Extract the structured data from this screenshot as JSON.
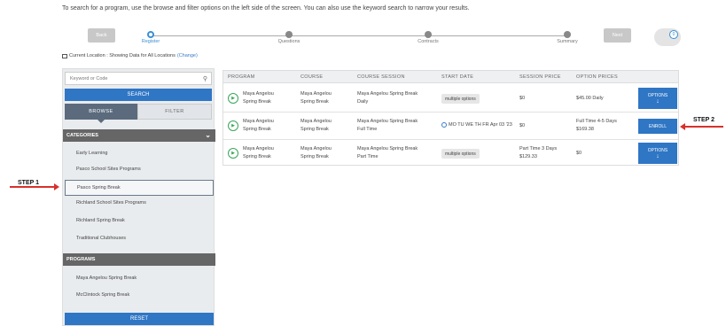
{
  "intro_text": "To search for a program, use the browse and filter options on the left side of the screen. You can also use the keyword search to narrow your results.",
  "wizard": {
    "back_label": "Back",
    "next_label": "Next",
    "steps": [
      {
        "label": "Register",
        "active": true
      },
      {
        "label": "Questions",
        "active": false
      },
      {
        "label": "Contracts",
        "active": false
      },
      {
        "label": "Summary",
        "active": false
      }
    ],
    "cart_count": "0"
  },
  "location": {
    "text": "Current Location : Showing Data for All Locations",
    "change_label": "(Change)"
  },
  "sidebar": {
    "keyword_placeholder": "Keyword or Code",
    "search_label": "SEARCH",
    "browse_label": "BROWSE",
    "filter_label": "FILTER",
    "categories_label": "CATEGORIES",
    "categories": [
      "Early Learning",
      "Pasco School Sites Programs",
      "Pasco Spring Break",
      "Richland School Sites Programs",
      "Richland Spring Break",
      "Traditional Clubhouses"
    ],
    "selected_category": "Pasco Spring Break",
    "programs_label": "PROGRAMS",
    "programs": [
      "Maya Angelou Spring Break",
      "McClintock Spring Break"
    ],
    "reset_label": "RESET"
  },
  "annotations": {
    "step1": "STEP 1",
    "step2": "STEP 2",
    "arrow_color": "#d9302c"
  },
  "table": {
    "headers": [
      "PROGRAM",
      "COURSE",
      "COURSE SESSION",
      "START DATE",
      "SESSION PRICE",
      "OPTION PRICES"
    ],
    "rows": [
      {
        "program": [
          "Maya Angelou",
          "Spring Break"
        ],
        "course": [
          "Maya Angelou",
          "Spring Break"
        ],
        "session": [
          "Maya Angelou Spring Break",
          "Daily"
        ],
        "start_date": "multiple options",
        "session_price": "$0",
        "option_prices": "$45.00 Daily",
        "action": "OPTIONS"
      },
      {
        "program": [
          "Maya Angelou",
          "Spring Break"
        ],
        "course": [
          "Maya Angelou",
          "Spring Break"
        ],
        "session": [
          "Maya Angelou Spring Break",
          "Full Time"
        ],
        "start_date": "MO TU WE TH FR Apr 03 '23",
        "session_price": "$0",
        "option_prices": [
          "Full Time 4-5 Days",
          "$169.38"
        ],
        "action": "ENROLL"
      },
      {
        "program": [
          "Maya Angelou",
          "Spring Break"
        ],
        "course": [
          "Maya Angelou",
          "Spring Break"
        ],
        "session": [
          "Maya Angelou Spring Break",
          "Part Time"
        ],
        "start_date": "multiple options",
        "session_price": [
          "Part Time 3 Days",
          "$129.33"
        ],
        "option_prices": "$0",
        "action": "OPTIONS"
      }
    ]
  },
  "colors": {
    "primary": "#2f76c5",
    "active_tab": "#5b6b7d",
    "section_head": "#666666",
    "step_active": "#3a8fd6"
  }
}
